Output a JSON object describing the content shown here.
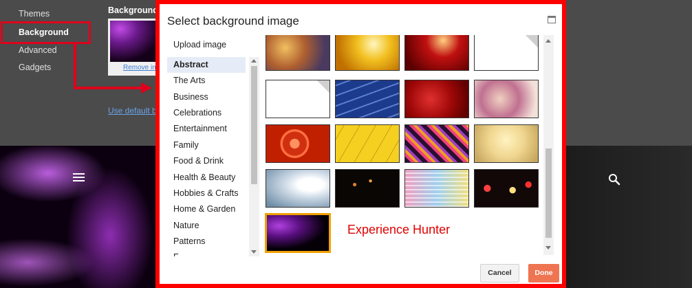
{
  "nav": {
    "items": [
      {
        "label": "Themes"
      },
      {
        "label": "Background"
      },
      {
        "label": "Advanced"
      },
      {
        "label": "Gadgets"
      }
    ]
  },
  "background_section": {
    "title": "Background",
    "remove_link": "Remove im",
    "use_default_link": "Use default ba"
  },
  "dialog": {
    "title": "Select background image",
    "categories": [
      {
        "label": "Upload image"
      },
      {
        "label": "Abstract"
      },
      {
        "label": "The Arts"
      },
      {
        "label": "Business"
      },
      {
        "label": "Celebrations"
      },
      {
        "label": "Entertainment"
      },
      {
        "label": "Family"
      },
      {
        "label": "Food & Drink"
      },
      {
        "label": "Health & Beauty"
      },
      {
        "label": "Hobbies & Crafts"
      },
      {
        "label": "Home & Garden"
      },
      {
        "label": "Nature"
      },
      {
        "label": "Patterns"
      },
      {
        "label": "F…"
      }
    ],
    "selected_category": "Abstract",
    "cancel_label": "Cancel",
    "done_label": "Done"
  },
  "watermark": "Experience Hunter",
  "colors": {
    "annotation_red": "#ff0000",
    "done_button": "#ef7451",
    "selection_border": "#f0a000",
    "panel_bg": "#4b4b4b"
  },
  "icons": [
    "hamburger-icon",
    "search-icon",
    "maximize-icon"
  ]
}
